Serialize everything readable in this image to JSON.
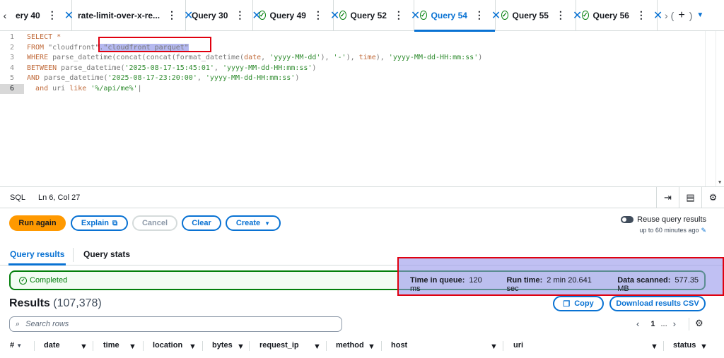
{
  "tabs": [
    {
      "label": "ery 40",
      "status": "none"
    },
    {
      "label": "rate-limit-over-x-re...",
      "status": "none"
    },
    {
      "label": "Query 30",
      "status": "none"
    },
    {
      "label": "Query 49",
      "status": "completed"
    },
    {
      "label": "Query 52",
      "status": "completed"
    },
    {
      "label": "Query 54",
      "status": "completed",
      "active": true
    },
    {
      "label": "Query 55",
      "status": "completed"
    },
    {
      "label": "Query 56",
      "status": "completed"
    }
  ],
  "editor": {
    "line_numbers": [
      "1",
      "2",
      "3",
      "4",
      "5",
      "6"
    ],
    "lines": [
      "SELECT *",
      "FROM \"cloudfront\".\"cloudfront_parquet\"",
      "WHERE parse_datetime(concat(concat(format_datetime(date, 'yyyy-MM-dd'), '-'), time), 'yyyy-MM-dd-HH:mm:ss')",
      "BETWEEN parse_datetime('2025-08-17-15:45:01', 'yyyy-MM-dd-HH:mm:ss')",
      "AND parse_datetime('2025-08-17-23:20:00', 'yyyy-MM-dd-HH:mm:ss')",
      "  and uri like '%/api/me%'"
    ]
  },
  "status_bar": {
    "language": "SQL",
    "position": "Ln 6, Col 27"
  },
  "actions": {
    "run_again": "Run again",
    "explain": "Explain",
    "cancel": "Cancel",
    "clear": "Clear",
    "create": "Create"
  },
  "reuse": {
    "label": "Reuse query results",
    "sub": "up to 60 minutes ago"
  },
  "result_tabs": {
    "results": "Query results",
    "stats": "Query stats"
  },
  "execution": {
    "status": "Completed",
    "time_in_queue_label": "Time in queue:",
    "time_in_queue": "120 ms",
    "run_time_label": "Run time:",
    "run_time": "2 min 20.641 sec",
    "data_scanned_label": "Data scanned:",
    "data_scanned": "577.35 MB"
  },
  "results": {
    "title": "Results",
    "count": "(107,378)",
    "copy": "Copy",
    "download": "Download results CSV",
    "search_placeholder": "Search rows",
    "page": "1",
    "ellipsis": "..."
  },
  "columns": [
    "#",
    "date",
    "time",
    "location",
    "bytes",
    "request_ip",
    "method",
    "host",
    "uri",
    "status"
  ],
  "colors": {
    "accent": "#0972d3",
    "success": "#037f0c",
    "primary_button": "#ff9900",
    "annotation": "#e0000f"
  }
}
